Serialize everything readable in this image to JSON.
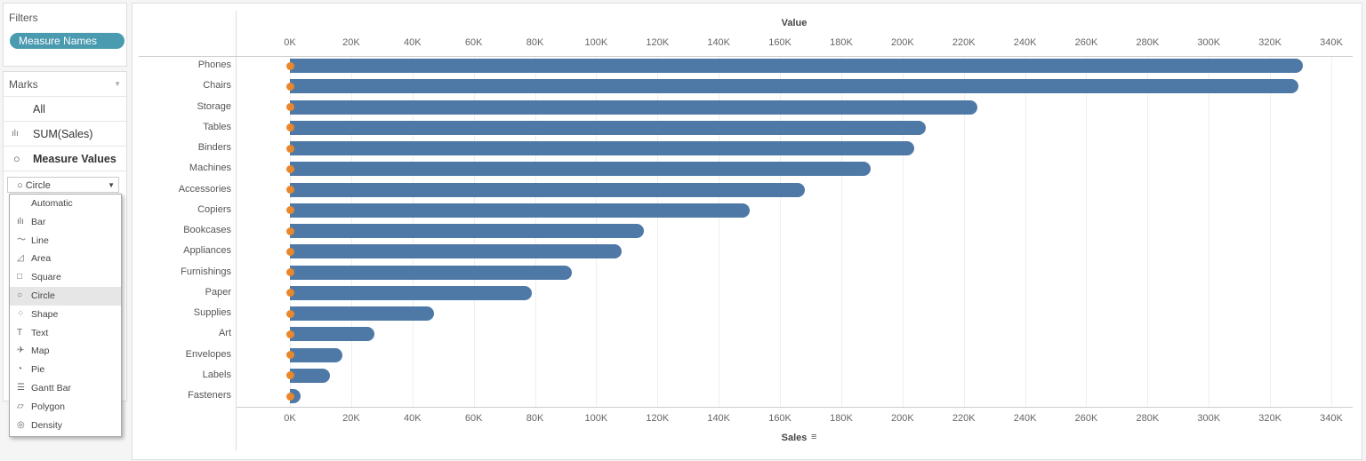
{
  "filters": {
    "title": "Filters",
    "pill": "Measure Names"
  },
  "marks": {
    "title": "Marks",
    "rows": [
      {
        "label": "All"
      },
      {
        "label": "SUM(Sales)",
        "icon": "bar-chart-icon"
      },
      {
        "label": "Measure Values",
        "icon": "circle-icon"
      }
    ],
    "mark_type": "Circle",
    "options": [
      {
        "label": "Automatic",
        "icon": ""
      },
      {
        "label": "Bar",
        "icon": "bar-chart-icon"
      },
      {
        "label": "Line",
        "icon": "line-icon"
      },
      {
        "label": "Area",
        "icon": "area-icon"
      },
      {
        "label": "Square",
        "icon": "square-icon"
      },
      {
        "label": "Circle",
        "icon": "circle-icon"
      },
      {
        "label": "Shape",
        "icon": "shape-icon"
      },
      {
        "label": "Text",
        "icon": "text-icon"
      },
      {
        "label": "Map",
        "icon": "map-icon"
      },
      {
        "label": "Pie",
        "icon": "pie-icon"
      },
      {
        "label": "Gantt Bar",
        "icon": "gantt-icon"
      },
      {
        "label": "Polygon",
        "icon": "polygon-icon"
      },
      {
        "label": "Density",
        "icon": "density-icon"
      }
    ],
    "highlighted": "Circle"
  },
  "colors": {
    "bar": "#4e79a7",
    "dot": "#e8872d",
    "pill": "#4a9ab0"
  },
  "chart_data": {
    "type": "bar",
    "orientation": "horizontal",
    "top_axis_title": "Value",
    "bottom_axis_title": "Sales",
    "xlim": [
      0,
      340000
    ],
    "ticks": [
      "0K",
      "20K",
      "40K",
      "60K",
      "80K",
      "100K",
      "120K",
      "140K",
      "160K",
      "180K",
      "200K",
      "220K",
      "240K",
      "260K",
      "280K",
      "300K",
      "320K",
      "340K"
    ],
    "categories": [
      "Phones",
      "Chairs",
      "Storage",
      "Tables",
      "Binders",
      "Machines",
      "Accessories",
      "Copiers",
      "Bookcases",
      "Appliances",
      "Furnishings",
      "Paper",
      "Supplies",
      "Art",
      "Envelopes",
      "Labels",
      "Fasteners"
    ],
    "series": [
      {
        "mark": "bar",
        "values": [
          330600,
          329200,
          224400,
          207500,
          203800,
          189600,
          168100,
          150100,
          115500,
          108300,
          92000,
          79000,
          47000,
          27600,
          17100,
          13100,
          3500
        ]
      },
      {
        "mark": "circle",
        "values": [
          0,
          0,
          0,
          0,
          0,
          0,
          0,
          0,
          0,
          0,
          0,
          0,
          0,
          0,
          0,
          0,
          0
        ]
      }
    ],
    "grid": "vertical"
  }
}
